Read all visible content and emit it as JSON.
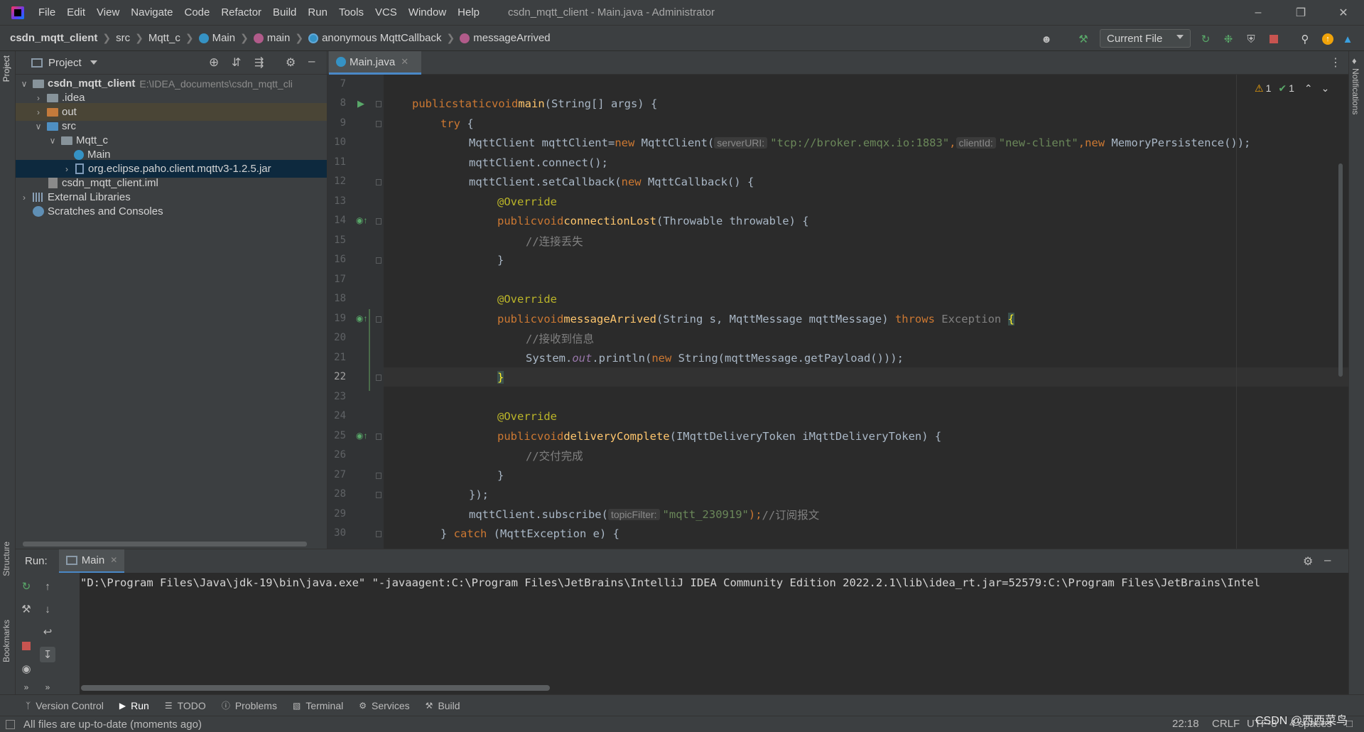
{
  "window": {
    "title": "csdn_mqtt_client - Main.java - Administrator",
    "menus": [
      "File",
      "Edit",
      "View",
      "Navigate",
      "Code",
      "Refactor",
      "Build",
      "Run",
      "Tools",
      "VCS",
      "Window",
      "Help"
    ]
  },
  "breadcrumb": {
    "items": [
      "csdn_mqtt_client",
      "src",
      "Mqtt_c",
      "Main",
      "main",
      "anonymous MqttCallback",
      "messageArrived"
    ]
  },
  "toolbar": {
    "run_config": "Current File"
  },
  "project": {
    "header": "Project",
    "tree": [
      {
        "label": "csdn_mqtt_client",
        "hint": "E:\\IDEA_documents\\csdn_mqtt_cli"
      },
      {
        "label": ".idea"
      },
      {
        "label": "out"
      },
      {
        "label": "src"
      },
      {
        "label": "Mqtt_c"
      },
      {
        "label": "Main"
      },
      {
        "label": "org.eclipse.paho.client.mqttv3-1.2.5.jar"
      },
      {
        "label": "csdn_mqtt_client.iml"
      },
      {
        "label": "External Libraries"
      },
      {
        "label": "Scratches and Consoles"
      }
    ]
  },
  "editor": {
    "tab": "Main.java",
    "current_line": 22,
    "inspections": {
      "warnings": "1",
      "ok": "1"
    },
    "line_numbers": [
      "7",
      "8",
      "9",
      "10",
      "11",
      "12",
      "13",
      "14",
      "15",
      "16",
      "17",
      "18",
      "19",
      "20",
      "21",
      "22",
      "23",
      "24",
      "25",
      "26",
      "27",
      "28",
      "29",
      "30"
    ],
    "code": {
      "l8_public": "public",
      "l8_static": "static",
      "l8_void": "void",
      "l8_main": "main",
      "l8_rest": "(String[] args) {",
      "l9_try": "try",
      "l9_rest": " {",
      "l10_a": "MqttClient mqttClient=",
      "l10_new": "new",
      "l10_b": " MqttClient(",
      "l10_hint1": "serverURI:",
      "l10_str1": "\"tcp://broker.emqx.io:1883\"",
      "l10_c": ",",
      "l10_hint2": "clientId:",
      "l10_str2": "\"new-client\"",
      "l10_d": ",",
      "l10_new2": "new",
      "l10_e": " MemoryPersistence());",
      "l11": "mqttClient.connect();",
      "l12_a": "mqttClient.setCallback(",
      "l12_new": "new",
      "l12_b": " MqttCallback() {",
      "l13": "@Override",
      "l14_public": "public",
      "l14_void": "void",
      "l14_fn": "connectionLost",
      "l14_rest": "(Throwable throwable) {",
      "l15": "//连接丢失",
      "l16": "}",
      "l18": "@Override",
      "l19_public": "public",
      "l19_void": "void",
      "l19_fn": "messageArrived",
      "l19_rest": "(String s, MqttMessage mqttMessage) ",
      "l19_throws": "throws",
      "l19_exc": " Exception ",
      "l19_brace": "{",
      "l20": "//接收到信息",
      "l21_a": "System.",
      "l21_out": "out",
      "l21_b": ".println(",
      "l21_new": "new",
      "l21_c": " String(mqttMessage.getPayload()));",
      "l22": "}",
      "l24": "@Override",
      "l25_public": "public",
      "l25_void": "void",
      "l25_fn": "deliveryComplete",
      "l25_rest": "(IMqttDeliveryToken iMqttDeliveryToken) {",
      "l26": "//交付完成",
      "l27": "}",
      "l28": "});",
      "l29_a": "mqttClient.subscribe(",
      "l29_hint": "topicFilter:",
      "l29_str": "\"mqtt_230919\"",
      "l29_b": ");",
      "l29_cmt": "//订阅报文",
      "l30_a": "} ",
      "l30_catch": "catch",
      "l30_b": " (MqttException e) {"
    }
  },
  "run_panel": {
    "label": "Run:",
    "tab": "Main",
    "console_line": "\"D:\\Program Files\\Java\\jdk-19\\bin\\java.exe\" \"-javaagent:C:\\Program Files\\JetBrains\\IntelliJ IDEA Community Edition 2022.2.1\\lib\\idea_rt.jar=52579:C:\\Program Files\\JetBrains\\Intel"
  },
  "tool_windows": [
    "Version Control",
    "Run",
    "TODO",
    "Problems",
    "Terminal",
    "Services",
    "Build"
  ],
  "side_tabs": {
    "project": "Project",
    "structure": "Structure",
    "bookmarks": "Bookmarks",
    "notifications": "Notifications"
  },
  "status": {
    "message": "All files are up-to-date (moments ago)",
    "position": "22:18",
    "line_sep": "CRLF",
    "encoding": "UTF-8",
    "indent": "4 spaces"
  },
  "watermark": "CSDN @西西菜鸟",
  "colors": {
    "keyword": "#cc7832",
    "function": "#ffc66d",
    "string": "#6a8759",
    "annotation": "#bbb529",
    "comment": "#808080",
    "selection": "#0d293e"
  }
}
